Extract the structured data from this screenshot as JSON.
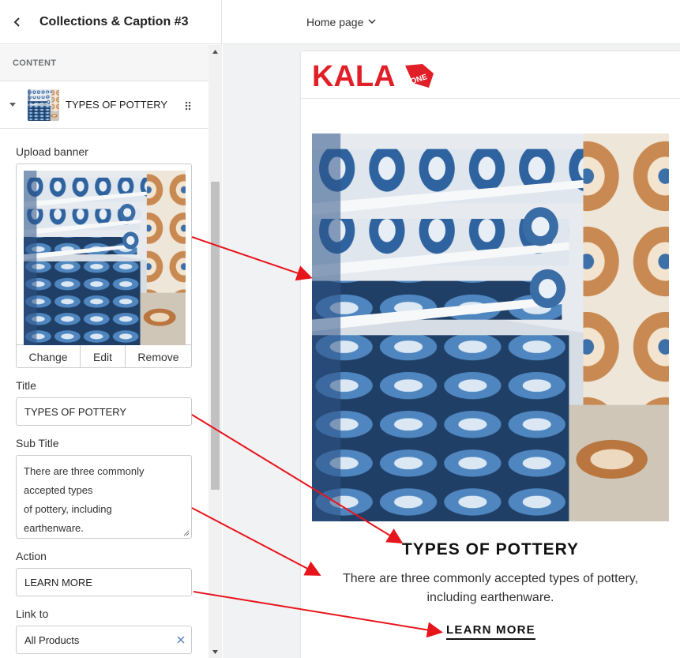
{
  "editor": {
    "title": "Collections & Caption #3",
    "section_label": "CONTENT",
    "block_name": "TYPES OF POTTERY",
    "upload_label": "Upload banner",
    "upload_actions": {
      "change": "Change",
      "edit": "Edit",
      "remove": "Remove"
    },
    "title_label": "Title",
    "title_value": "TYPES OF POTTERY",
    "subtitle_label": "Sub Title",
    "subtitle_lines": [
      "There are three commonly",
      "accepted types",
      "of pottery, including",
      "earthenware."
    ],
    "action_label": "Action",
    "action_value": "LEARN MORE",
    "link_label": "Link to",
    "link_value": "All Products"
  },
  "topbar": {
    "page_selector": "Home page"
  },
  "preview": {
    "logo": "KALA",
    "logo_badge": "ONE",
    "title": "TYPES OF POTTERY",
    "subtitle": "There are three commonly accepted types of pottery, including earthenware.",
    "button": "LEARN MORE"
  },
  "colors": {
    "brand_red": "#e01f27",
    "annotation_arrow": "#e8141c",
    "pottery_blue": "#2a5b8f"
  },
  "icons": [
    "back-chevron-icon",
    "caret-down-icon",
    "drag-handle-icon",
    "chevron-down-icon",
    "clear-x-icon",
    "resize-handle-icon",
    "scroll-up-arrow-icon",
    "scroll-down-arrow-icon"
  ]
}
